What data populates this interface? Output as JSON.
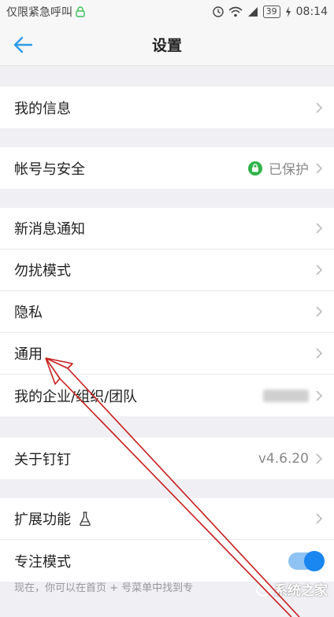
{
  "status_bar": {
    "left_text": "仅限紧急呼叫",
    "battery": "39",
    "time": "08:14"
  },
  "nav": {
    "title": "设置"
  },
  "groups": [
    {
      "rows": [
        {
          "label": "我的信息"
        }
      ]
    },
    {
      "rows": [
        {
          "label": "帐号与安全",
          "value": "已保护"
        }
      ]
    },
    {
      "rows": [
        {
          "label": "新消息通知"
        },
        {
          "label": "勿扰模式"
        },
        {
          "label": "隐私"
        },
        {
          "label": "通用"
        },
        {
          "label": "我的企业/组织/团队"
        }
      ]
    },
    {
      "rows": [
        {
          "label": "关于钉钉",
          "value": "v4.6.20"
        }
      ]
    },
    {
      "rows": [
        {
          "label": "扩展功能"
        },
        {
          "label": "专注模式",
          "toggle": true
        }
      ]
    }
  ],
  "footer_note": "现在，你可以在首页 + 号菜单中找到专",
  "watermark": "系统之家",
  "colors": {
    "accent": "#1a86f0",
    "back_arrow": "#2d9be8",
    "lock_green": "#2fb44a",
    "annotation_red": "#c81e1e"
  }
}
